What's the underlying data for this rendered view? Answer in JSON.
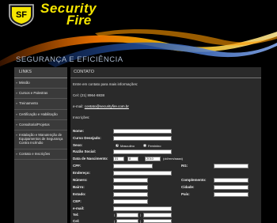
{
  "brand": {
    "word1": "Security",
    "word2": "Fire",
    "tagline": "SEGURANÇA E EFICIÊNCIA",
    "accent_color": "#f6e600"
  },
  "sidebar": {
    "title": "LINKS",
    "items": [
      {
        "label": "Missão"
      },
      {
        "label": "Cursos e Palestras"
      },
      {
        "label": "Treinamento"
      },
      {
        "label": "Certificação e Habilitação"
      },
      {
        "label": "Consultoria/Projetos"
      },
      {
        "label": "Instalação e Manutenção de Equipamentos de Segurança Contra Incêndio"
      },
      {
        "label": "Contato e Inscrições"
      }
    ]
  },
  "main": {
    "title": "CONTATO",
    "intro": "Entre em contato para mais informações:",
    "phone": "Cel: (21) 8964-8838",
    "email_prefix": "e-mail: ",
    "email": "contato@securityfire.com.br",
    "section": "Inscrições:"
  },
  "form": {
    "nome": "Nome:",
    "curso": "Curso Desejado:",
    "sexo": "Sexo:",
    "masculino": "Masculino",
    "feminino": "Feminino",
    "razao": "Razão Social:",
    "nascimento": "Data de Nascimento:",
    "day": "31",
    "month": "8",
    "year": "2010",
    "date_hint": "(dd/mm/aaaa)",
    "cpf": "CPF:",
    "rg": "RG:",
    "endereco": "Endereço:",
    "numero": "Número:",
    "complemento": "Complemento:",
    "bairro": "Bairro:",
    "cidade": "Cidade:",
    "estado": "Estado:",
    "pais": "País:",
    "cep": "CEP:",
    "email": "e-mail:",
    "tel": "Tel:",
    "cel": "Cel:",
    "paren_open": "(",
    "paren_close": ")"
  }
}
